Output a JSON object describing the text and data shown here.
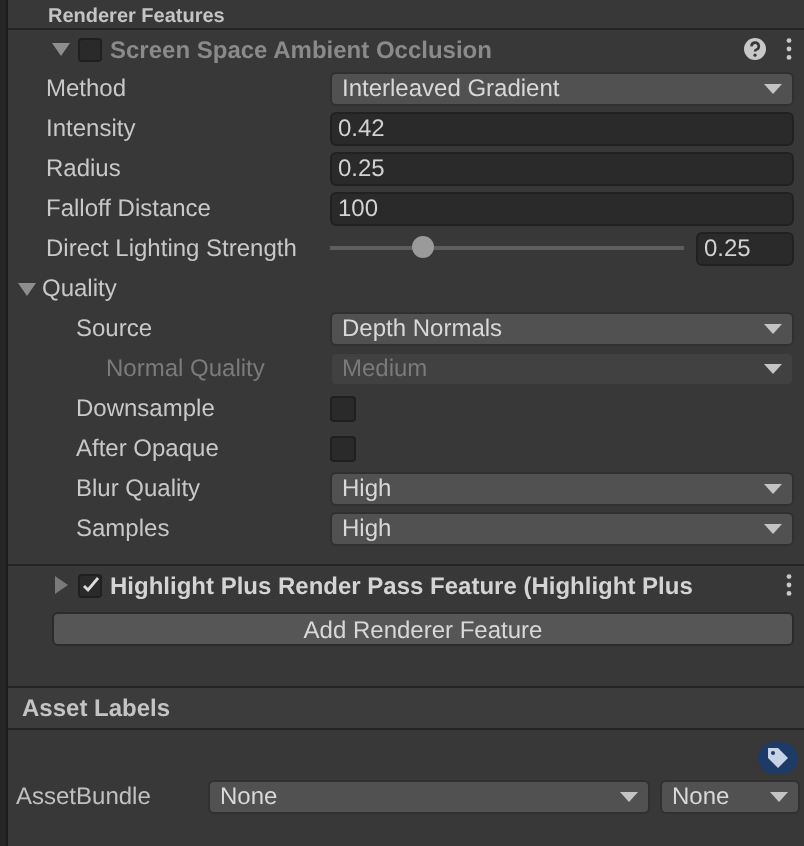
{
  "header": {
    "title": "Renderer Features"
  },
  "features": [
    {
      "title": "Screen Space Ambient Occlusion",
      "enabled": false,
      "expanded": true,
      "help": true,
      "properties": [
        {
          "kind": "dropdown",
          "label": "Method",
          "value": "Interleaved Gradient",
          "disabled": false
        },
        {
          "kind": "field",
          "label": "Intensity",
          "value": "0.42",
          "disabled": false
        },
        {
          "kind": "field",
          "label": "Radius",
          "value": "0.25",
          "disabled": false
        },
        {
          "kind": "field",
          "label": "Falloff Distance",
          "value": "100",
          "disabled": false
        },
        {
          "kind": "slider",
          "label": "Direct Lighting Strength",
          "level": 0.26,
          "value": "0.25",
          "disabled": false
        },
        {
          "kind": "foldout",
          "label": "Quality",
          "expanded": true,
          "disabled": false,
          "children": [
            {
              "kind": "dropdown",
              "label": "Source",
              "value": "Depth Normals",
              "disabled": false,
              "children": [
                {
                  "kind": "dropdown",
                  "label": "Normal Quality",
                  "value": "Medium",
                  "disabled": true
                }
              ]
            },
            {
              "kind": "checkbox",
              "label": "Downsample",
              "checked": false,
              "disabled": false
            },
            {
              "kind": "checkbox",
              "label": "After Opaque",
              "checked": false,
              "disabled": false
            },
            {
              "kind": "dropdown",
              "label": "Blur Quality",
              "value": "High",
              "disabled": false
            },
            {
              "kind": "dropdown",
              "label": "Samples",
              "value": "High",
              "disabled": false
            }
          ]
        }
      ]
    },
    {
      "title": "Highlight Plus Render Pass Feature (Highlight Plus",
      "enabled": true,
      "expanded": false,
      "help": false
    }
  ],
  "add_button": "Add Renderer Feature",
  "asset_labels": {
    "title": "Asset Labels",
    "bundle_label": "AssetBundle",
    "bundle_value": "None",
    "variant_value": "None"
  }
}
